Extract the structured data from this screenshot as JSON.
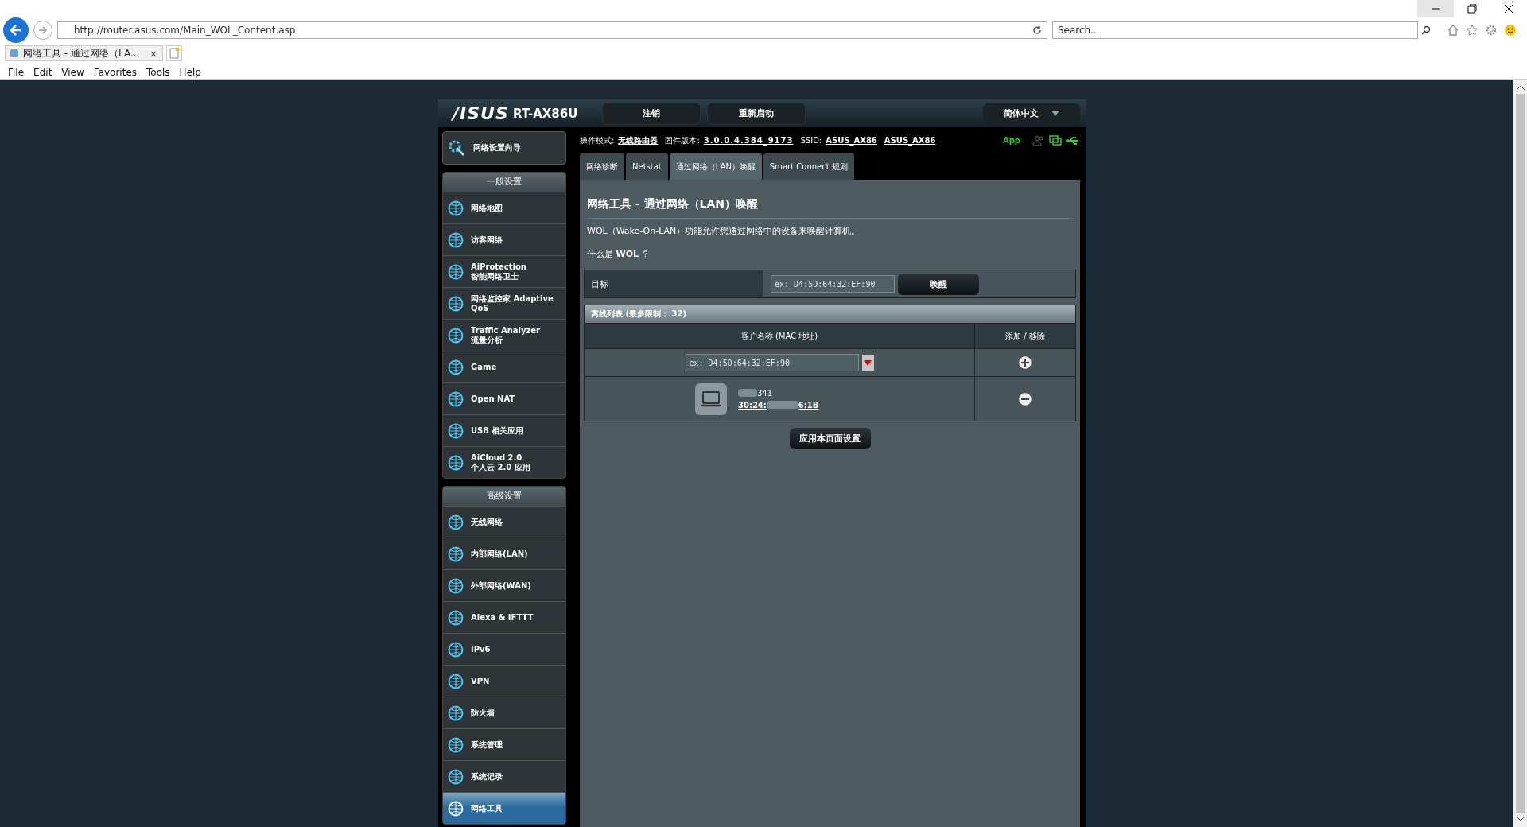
{
  "browser": {
    "address": "http://router.asus.com/Main_WOL_Content.asp",
    "search_placeholder": "Search...",
    "tab_title": "网络工具 - 通过网络（LA...",
    "tab_close": "×",
    "menu": [
      "File",
      "Edit",
      "View",
      "Favorites",
      "Tools",
      "Help"
    ]
  },
  "header": {
    "logo": "/ISUS",
    "model": "RT-AX86U",
    "buttons": [
      "注销",
      "重新启动"
    ],
    "language": "简体中文"
  },
  "status": {
    "mode_label": "操作模式:",
    "mode": "无线路由器",
    "firmware_label": "固件版本:",
    "firmware": "3.0.0.4.384_9173",
    "ssid_label": "SSID:",
    "ssids": [
      "ASUS_AX86",
      "ASUS_AX86"
    ],
    "app": "App"
  },
  "sidebar": {
    "wizard": "网络设置向导",
    "sections": [
      {
        "title": "一般设置",
        "items": [
          {
            "label": "网络地图",
            "selected": false
          },
          {
            "label": "访客网络",
            "selected": false
          },
          {
            "label": "AiProtection\n智能网络卫士",
            "selected": false
          },
          {
            "label": "网络监控家 Adaptive\nQoS",
            "selected": false
          },
          {
            "label": "Traffic Analyzer\n流量分析",
            "selected": false
          },
          {
            "label": "Game",
            "selected": false
          },
          {
            "label": "Open NAT",
            "selected": false
          },
          {
            "label": "USB 相关应用",
            "selected": false
          },
          {
            "label": "AiCloud 2.0\n个人云 2.0 应用",
            "selected": false
          }
        ]
      },
      {
        "title": "高级设置",
        "items": [
          {
            "label": "无线网络",
            "selected": false
          },
          {
            "label": "内部网络(LAN)",
            "selected": false
          },
          {
            "label": "外部网络(WAN)",
            "selected": false
          },
          {
            "label": "Alexa & IFTTT",
            "selected": false
          },
          {
            "label": "IPv6",
            "selected": false
          },
          {
            "label": "VPN",
            "selected": false
          },
          {
            "label": "防火墙",
            "selected": false
          },
          {
            "label": "系统管理",
            "selected": false
          },
          {
            "label": "系统记录",
            "selected": false
          },
          {
            "label": "网络工具",
            "selected": true
          }
        ]
      }
    ]
  },
  "tabs": [
    {
      "label": "网络诊断",
      "selected": false
    },
    {
      "label": "Netstat",
      "selected": false
    },
    {
      "label": "通过网络（LAN）唤醒",
      "selected": true
    },
    {
      "label": "Smart Connect 规则",
      "selected": false
    }
  ],
  "content": {
    "title": "网络工具 - 通过网络（LAN）唤醒",
    "description": "WOL（Wake-On-LAN）功能允许您通过网络中的设备来唤醒计算机。",
    "help_prefix": "什么是",
    "help_link": "WOL",
    "help_suffix": "？",
    "target": {
      "label": "目标",
      "placeholder": "ex: D4:5D:64:32:EF:90",
      "button": "唤醒"
    },
    "offline_list": {
      "title": "离线列表 (最多限制： 32)",
      "columns": [
        "客户名称 (MAC 地址)",
        "添加 / 移除"
      ],
      "add_placeholder": "ex: D4:5D:64:32:EF:90",
      "clients": [
        {
          "name": "341",
          "mac_start": "30:24:",
          "mac_end": "6:1B"
        }
      ]
    },
    "apply": "应用本页面设置"
  }
}
